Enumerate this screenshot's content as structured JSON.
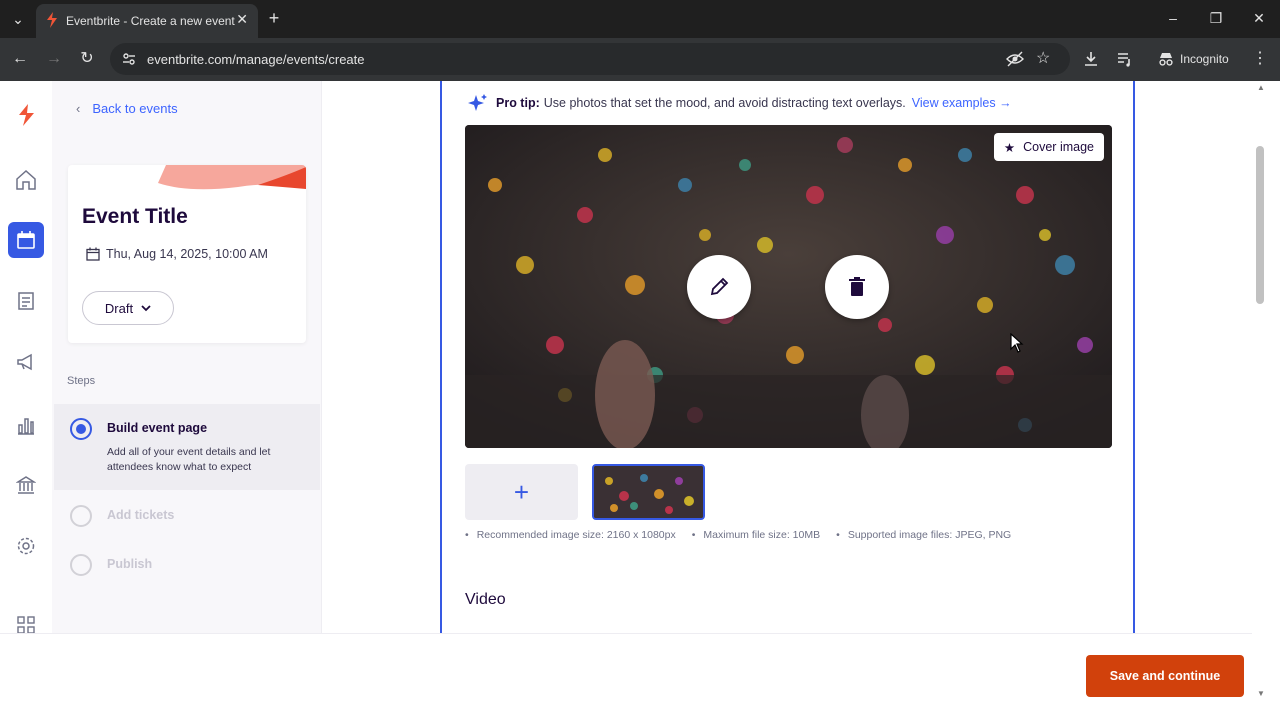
{
  "browser": {
    "tab_title": "Eventbrite - Create a new event",
    "url": "eventbrite.com/manage/events/create",
    "incognito_label": "Incognito",
    "tab_icon": "eventbrite-favicon"
  },
  "sidebar": {
    "back_label": "Back to events",
    "event_title": "Event Title",
    "event_date": "Thu, Aug 14, 2025, 10:00 AM",
    "status_label": "Draft",
    "steps_label": "Steps",
    "steps": [
      {
        "title": "Build event page",
        "description": "Add all of your event details and let attendees know what to expect",
        "state": "active"
      },
      {
        "title": "Add tickets",
        "state": "disabled"
      },
      {
        "title": "Publish",
        "state": "disabled"
      }
    ]
  },
  "main": {
    "pro_tip_label": "Pro tip:",
    "pro_tip_text": "Use photos that set the mood, and avoid distracting text overlays.",
    "view_examples": "View examples →",
    "cover_badge": "Cover image",
    "specs": [
      "Recommended image size: 2160 x 1080px",
      "Maximum file size: 10MB",
      "Supported image files: JPEG, PNG"
    ],
    "video_heading": "Video"
  },
  "footer": {
    "save_label": "Save and continue"
  },
  "colors": {
    "accent": "#3659e3",
    "brand": "#d1410c",
    "link": "#3d64ff"
  }
}
